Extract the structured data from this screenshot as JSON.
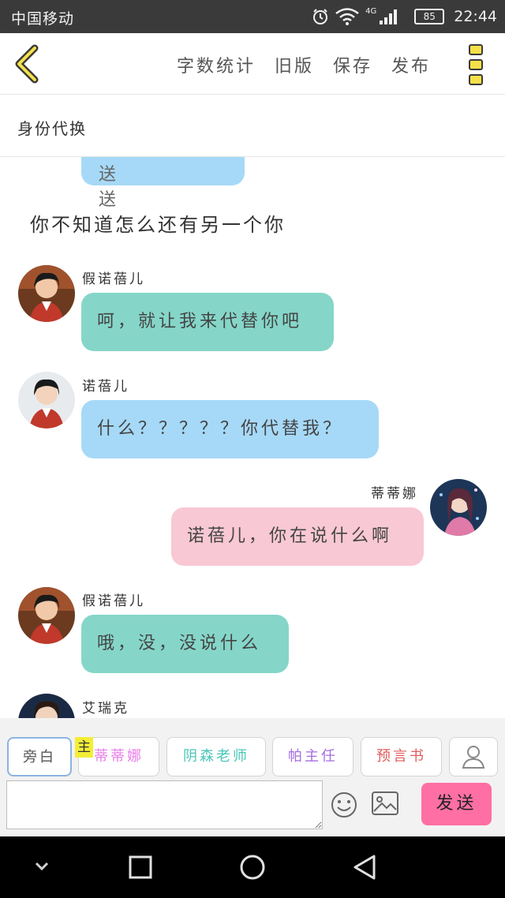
{
  "status_bar": {
    "carrier": "中国移动",
    "network_type": "4G",
    "battery": "85",
    "time": "22:44"
  },
  "top_bar": {
    "actions": [
      {
        "id": "word-count",
        "label": "字数统计"
      },
      {
        "id": "old-version",
        "label": "旧版"
      },
      {
        "id": "save",
        "label": "保存"
      },
      {
        "id": "publish",
        "label": "发布"
      }
    ]
  },
  "identity_bar": {
    "label": "身份代换"
  },
  "chat": {
    "partial_bubble_text": "送 送",
    "narration": "你不知道怎么还有另一个你",
    "messages": [
      {
        "speaker": "假诺蓓儿",
        "text": "呵，就让我来代替你吧",
        "side": "left",
        "color": "teal"
      },
      {
        "speaker": "诺蓓儿",
        "text": "什么？？？？？你代替我？",
        "side": "left",
        "color": "blue"
      },
      {
        "speaker": "蒂蒂娜",
        "text": "诺蓓儿，你在说什么啊",
        "side": "right",
        "color": "pink"
      },
      {
        "speaker": "假诺蓓儿",
        "text": "哦，没，没说什么",
        "side": "left",
        "color": "teal"
      },
      {
        "speaker": "艾瑞克",
        "text": "",
        "side": "left",
        "color": "blue"
      }
    ]
  },
  "role_bar": {
    "main_tag": "主",
    "roles": [
      {
        "label": "旁白",
        "color": "#555555",
        "selected": true
      },
      {
        "label": "蒂蒂娜",
        "color": "#e87de8",
        "selected": false
      },
      {
        "label": "阴森老师",
        "color": "#4cc6b8",
        "selected": false
      },
      {
        "label": "帕主任",
        "color": "#a46ee0",
        "selected": false
      },
      {
        "label": "预言书",
        "color": "#e25b5b",
        "selected": false
      }
    ]
  },
  "composer": {
    "input_value": "",
    "send_label": "发送"
  },
  "colors": {
    "blue_bubble": "#a6d9f7",
    "teal_bubble": "#85d6c9",
    "pink_bubble": "#f8c8d4",
    "send_button": "#ff6fa4",
    "menu_yellow": "#f4e14a"
  }
}
